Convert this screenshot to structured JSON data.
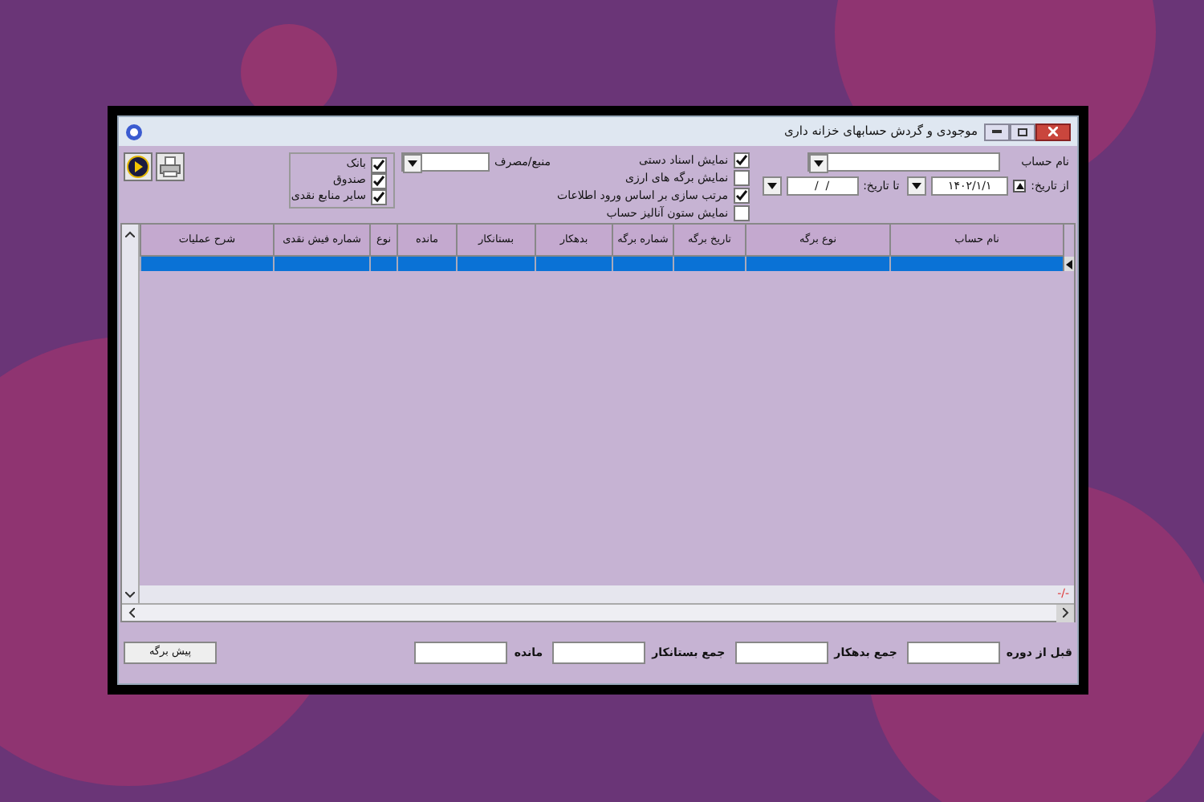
{
  "window": {
    "title": "موجودی و گردش حسابهای خزانه داری"
  },
  "filters": {
    "account_label": "نام حساب",
    "from_label": "از تاریخ:",
    "from_checked": true,
    "from_value": "۱۴۰۲/۱/۱",
    "to_label": "تا تاریخ:",
    "to_value": " /  / ",
    "source_label": "منبع/مصرف"
  },
  "options": [
    {
      "label": "نمایش اسناد دستی",
      "checked": true
    },
    {
      "label": "نمایش برگه های ارزی",
      "checked": false
    },
    {
      "label": "مرتب سازی بر اساس ورود اطلاعات",
      "checked": true
    },
    {
      "label": "نمایش ستون آنالیز حساب",
      "checked": false
    }
  ],
  "sources": [
    {
      "label": "بانک",
      "checked": true
    },
    {
      "label": "صندوق",
      "checked": true
    },
    {
      "label": "سایر منابع نقدی",
      "checked": true
    }
  ],
  "grid": {
    "columns": [
      "نام حساب",
      "نوع برگه",
      "تاریخ برگه",
      "شماره برگه",
      "بدهکار",
      "بستانکار",
      "مانده",
      "نوع",
      "شماره فیش نقدی",
      "شرح عملیات"
    ],
    "rows": [
      {
        "selected": true
      }
    ],
    "footer": "-/-"
  },
  "totals": [
    {
      "label": "قبل از دوره"
    },
    {
      "label": "جمع بدهکار"
    },
    {
      "label": "جمع بستانکار"
    },
    {
      "label": "مانده"
    }
  ],
  "preview_button": "پیش برگه"
}
